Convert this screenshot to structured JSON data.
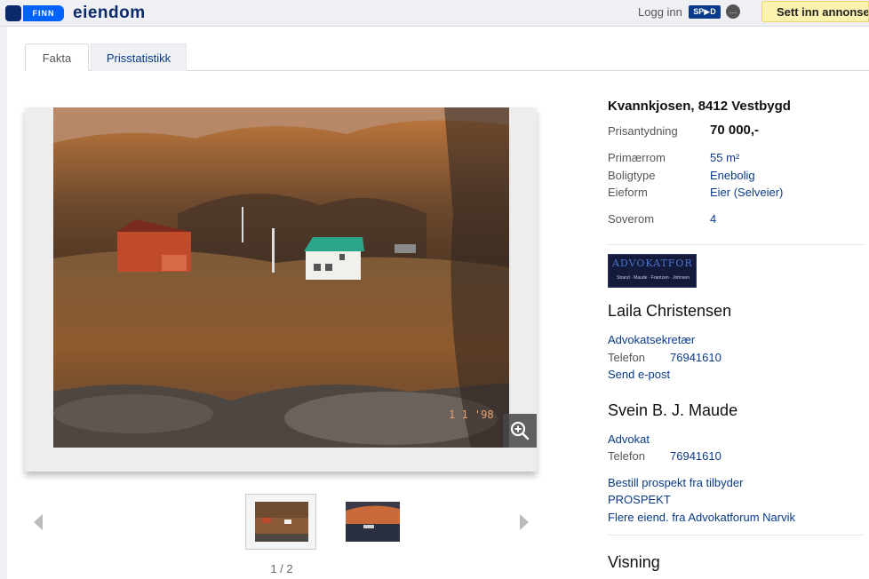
{
  "header": {
    "brand_finn": "FINN",
    "brand_section": "eiendom",
    "login_label": "Logg inn",
    "spid_label": "SP▶D",
    "cta_label": "Sett inn annonse",
    "colors": {
      "brand_dark": "#0a2a6b",
      "brand_blue": "#0063fb",
      "cta_bg": "#fdf3b0"
    }
  },
  "tabs": [
    {
      "label": "Fakta",
      "active": true
    },
    {
      "label": "Prisstatistikk",
      "active": false
    }
  ],
  "gallery": {
    "pager": "1 / 2",
    "zoom_icon": "zoom-in-icon"
  },
  "listing": {
    "address": "Kvannkjosen, 8412 Vestbygd",
    "price_label": "Prisantydning",
    "price_value": "70 000,-",
    "facts": [
      {
        "label": "Primærrom",
        "value": "55 m²"
      },
      {
        "label": "Boligtype",
        "value": "Enebolig"
      },
      {
        "label": "Eieform",
        "value": "Eier (Selveier)"
      }
    ],
    "bedrooms_label": "Soverom",
    "bedrooms_value": "4"
  },
  "agency": {
    "logo_text": "ADVOKATFORUM",
    "logo_subtext": "Strand · Maude · Frantzen · Johnsen",
    "contacts": [
      {
        "name": "Laila Christensen",
        "role": "Advokatsekretær",
        "phone_label": "Telefon",
        "phone": "76941610",
        "email_link": "Send e-post"
      },
      {
        "name": "Svein B. J. Maude",
        "role": "Advokat",
        "phone_label": "Telefon",
        "phone": "76941610"
      }
    ],
    "links": [
      "Bestill prospekt fra tilbyder",
      "PROSPEKT",
      "Flere eiend. fra Advokatforum Narvik"
    ]
  },
  "visning_heading": "Visning"
}
